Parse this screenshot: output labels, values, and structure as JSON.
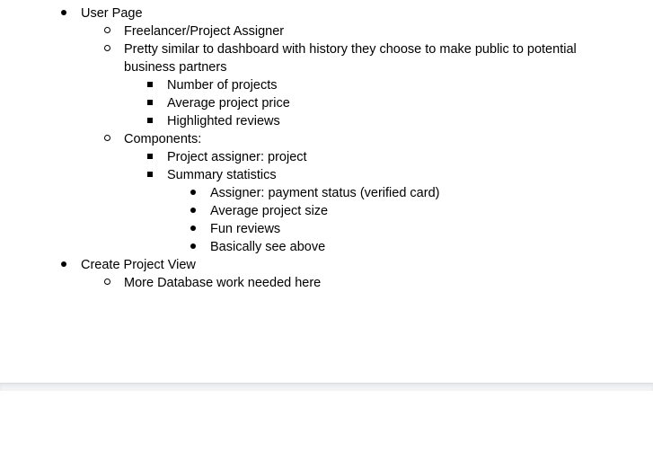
{
  "document": {
    "items": [
      {
        "level": 0,
        "bullet": "disc",
        "text": "User Page"
      },
      {
        "level": 1,
        "bullet": "circle",
        "text": "Freelancer/Project Assigner"
      },
      {
        "level": 1,
        "bullet": "circle",
        "text": "Pretty similar to dashboard with history they choose to make public to potential business partners"
      },
      {
        "level": 2,
        "bullet": "square",
        "text": "Number of projects"
      },
      {
        "level": 2,
        "bullet": "square",
        "text": "Average project price"
      },
      {
        "level": 2,
        "bullet": "square",
        "text": "Highlighted reviews"
      },
      {
        "level": 1,
        "bullet": "circle",
        "text": "Components:"
      },
      {
        "level": 2,
        "bullet": "square",
        "text": "Project assigner: project"
      },
      {
        "level": 2,
        "bullet": "square",
        "text": "Summary statistics"
      },
      {
        "level": 3,
        "bullet": "disc",
        "text": "Assigner: payment status (verified card)"
      },
      {
        "level": 3,
        "bullet": "disc",
        "text": "Average project size"
      },
      {
        "level": 3,
        "bullet": "disc",
        "text": "Fun reviews"
      },
      {
        "level": 3,
        "bullet": "disc",
        "text": "Basically see above"
      },
      {
        "level": 0,
        "bullet": "disc",
        "text": "Create Project View"
      },
      {
        "level": 1,
        "bullet": "circle",
        "text": "More Database work needed here"
      }
    ]
  }
}
